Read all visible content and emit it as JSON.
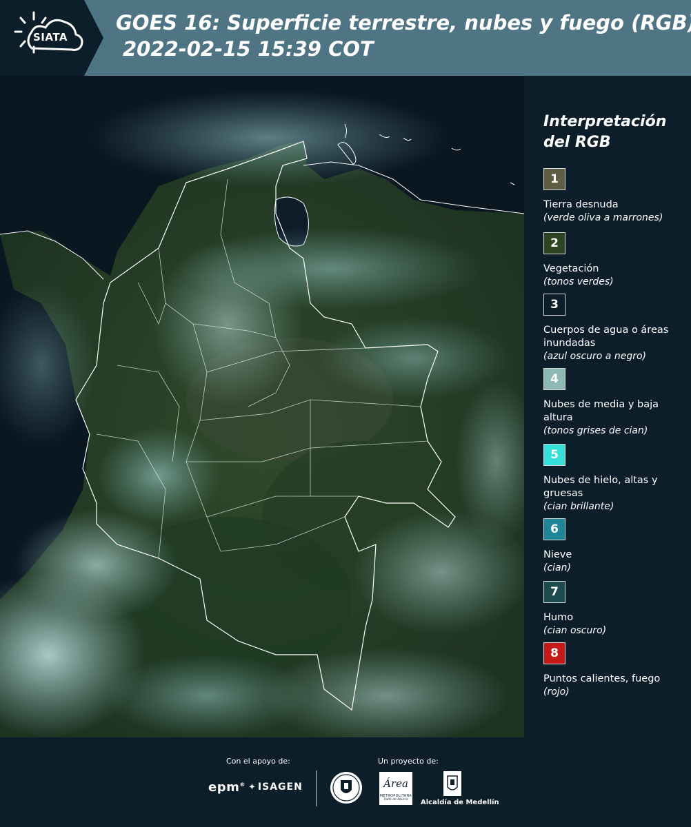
{
  "header": {
    "logo_text": "SIATA",
    "title_line1": "GOES 16: Superficie terrestre, nubes y fuego (RGB)",
    "title_line2": "2022-02-15 15:39 COT"
  },
  "legend": {
    "title": "Interpretación del RGB",
    "items": [
      {
        "number": "1",
        "label": "Tierra desnuda",
        "note": "(verde oliva a marrones)",
        "color": "#5e5e44"
      },
      {
        "number": "2",
        "label": "Vegetación",
        "note": "(tonos verdes)",
        "color": "#2c4421"
      },
      {
        "number": "3",
        "label": "Cuerpos de agua o áreas inundadas",
        "note": "(azul oscuro a negro)",
        "color": "#0d1e2b"
      },
      {
        "number": "4",
        "label": "Nubes de media y baja altura",
        "note": "(tonos grises de cian)",
        "color": "#8cb8b6"
      },
      {
        "number": "5",
        "label": "Nubes de hielo, altas y gruesas",
        "note": "(cian brillante)",
        "color": "#36e0da"
      },
      {
        "number": "6",
        "label": "Nieve",
        "note": "(cian)",
        "color": "#1e8598"
      },
      {
        "number": "7",
        "label": "Humo",
        "note": "(cian oscuro)",
        "color": "#1c4c50"
      },
      {
        "number": "8",
        "label": "Puntos calientes, fuego",
        "note": "(rojo)",
        "color": "#c41a1a"
      }
    ]
  },
  "footer": {
    "support_label": "Con el apoyo de:",
    "project_label": "Un proyecto de:",
    "sponsors": {
      "epm": "epm",
      "isagen": "ISAGEN",
      "area_metropolitana": "Área",
      "area_sub": "METROPOLITANA",
      "area_sub2": "Valle de Aburrá",
      "alcaldia": "Alcaldía de Medellín"
    }
  },
  "colors": {
    "header_bg": "#4f7585",
    "page_bg": "#0d1e2b",
    "border": "#d8d8d8"
  }
}
